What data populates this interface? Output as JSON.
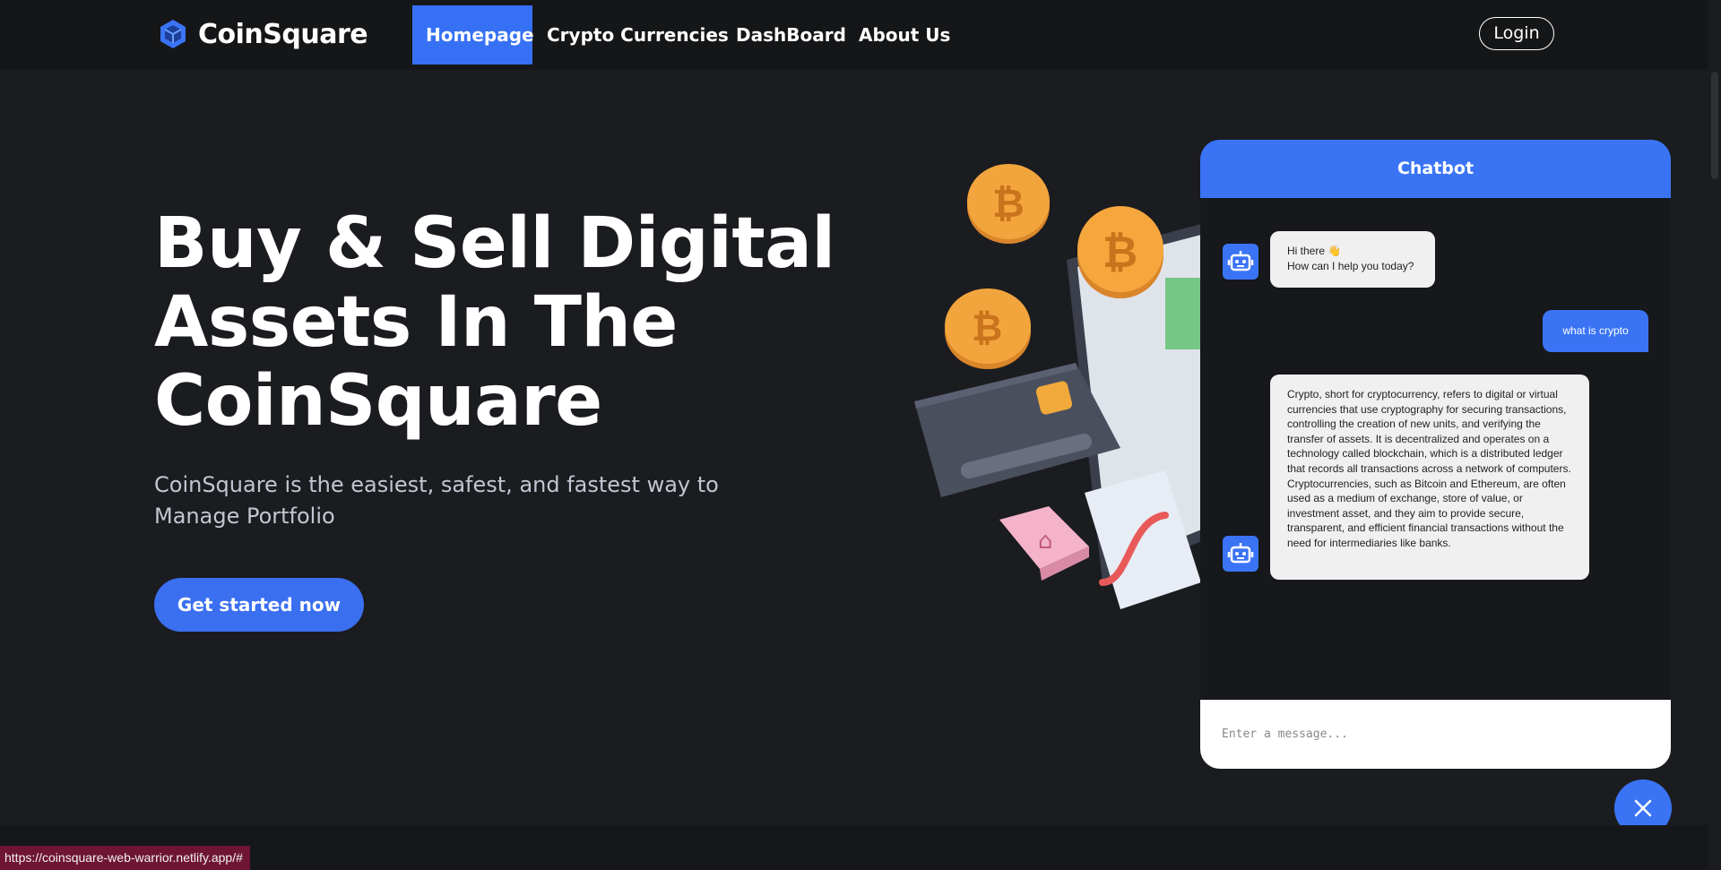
{
  "brand": {
    "name": "CoinSquare"
  },
  "nav": {
    "items": [
      {
        "label": "Homepage",
        "active": true
      },
      {
        "label": "Crypto Currencies"
      },
      {
        "label": "DashBoard"
      },
      {
        "label": "About Us"
      }
    ],
    "login_label": "Login"
  },
  "hero": {
    "title_lines": [
      "Buy & Sell Digital",
      "Assets In The",
      "CoinSquare"
    ],
    "subtitle": "CoinSquare is the easiest, safest, and fastest way to Manage Portfolio",
    "cta_label": "Get started now"
  },
  "chatbot": {
    "title": "Chatbot",
    "messages": [
      {
        "role": "bot",
        "text": "Hi there 👋\nHow can I help you today?"
      },
      {
        "role": "user",
        "text": "what is crypto"
      },
      {
        "role": "bot",
        "text": "Crypto, short for cryptocurrency, refers to digital or virtual currencies that use cryptography for securing transactions, controlling the creation of new units, and verifying the transfer of assets. It is decentralized and operates on a technology called blockchain, which is a distributed ledger that records all transactions across a network of computers. Cryptocurrencies, such as Bitcoin and Ethereum, are often used as a medium of exchange, store of value, or investment asset, and they aim to provide secure, transparent, and efficient financial transactions without the need for intermediaries like banks."
      }
    ],
    "input_placeholder": "Enter a message..."
  },
  "status_bar": {
    "url": "https://coinsquare-web-warrior.netlify.app/#"
  },
  "colors": {
    "accent": "#3a74f5",
    "background": "#1b1c20",
    "navbar": "#151618"
  },
  "icons": {
    "logo": "cube-icon",
    "bot": "robot-icon",
    "close": "close-icon"
  }
}
